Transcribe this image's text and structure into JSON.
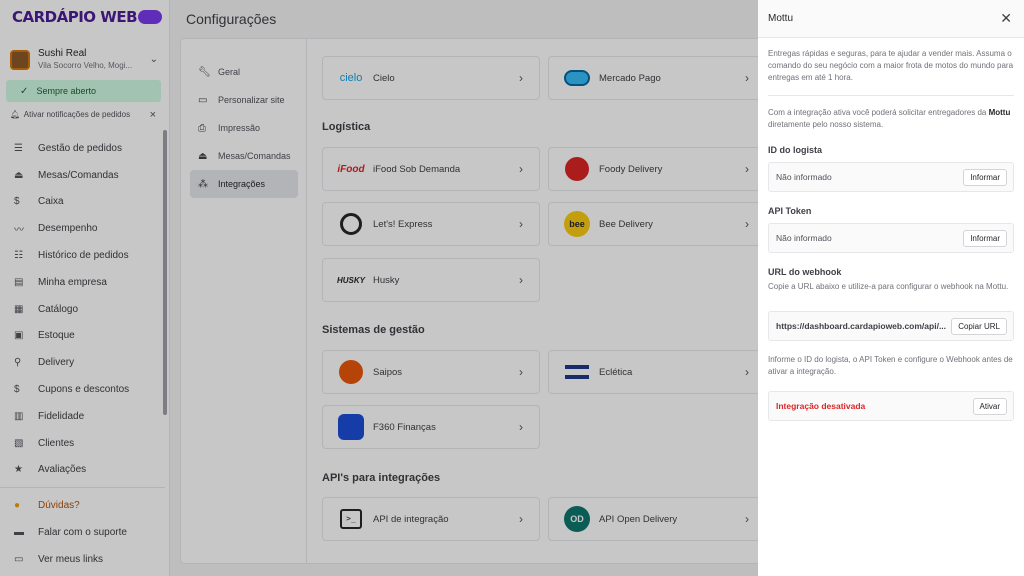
{
  "app": {
    "logo_text": "CARDÁPIO WEB"
  },
  "store": {
    "name": "Sushi Real",
    "address": "Vila Socorro Velho, Mogi..."
  },
  "status_badge": "Sempre aberto",
  "notifications_prompt": "Ativar notificações de pedidos",
  "menu": [
    {
      "label": "Gestão de pedidos",
      "icon": "orders-icon"
    },
    {
      "label": "Mesas/Comandas",
      "icon": "tables-icon"
    },
    {
      "label": "Caixa",
      "icon": "cash-icon"
    },
    {
      "label": "Desempenho",
      "icon": "chart-icon"
    },
    {
      "label": "Histórico de pedidos",
      "icon": "history-icon"
    },
    {
      "label": "Minha empresa",
      "icon": "store-icon"
    },
    {
      "label": "Catálogo",
      "icon": "catalog-icon"
    },
    {
      "label": "Estoque",
      "icon": "stock-icon"
    },
    {
      "label": "Delivery",
      "icon": "bike-icon"
    },
    {
      "label": "Cupons e descontos",
      "icon": "dollar-icon"
    },
    {
      "label": "Fidelidade",
      "icon": "gift-icon"
    },
    {
      "label": "Clientes",
      "icon": "contacts-icon"
    },
    {
      "label": "Avaliações",
      "icon": "star-icon"
    }
  ],
  "menu_bottom": [
    {
      "label": "Dúvidas?",
      "icon": "help-icon"
    },
    {
      "label": "Falar com o suporte",
      "icon": "chat-icon"
    },
    {
      "label": "Ver meus links",
      "icon": "links-icon"
    }
  ],
  "page_title": "Configurações",
  "settings_nav": [
    {
      "label": "Geral",
      "icon": "wrench-icon"
    },
    {
      "label": "Personalizar site",
      "icon": "browser-icon"
    },
    {
      "label": "Impressão",
      "icon": "printer-icon"
    },
    {
      "label": "Mesas/Comandas",
      "icon": "tables-icon"
    },
    {
      "label": "Integrações",
      "icon": "integrations-icon"
    }
  ],
  "payments": [
    {
      "name": "Cielo",
      "logo": "cielo"
    },
    {
      "name": "Mercado Pago",
      "logo": ""
    }
  ],
  "sections": {
    "logistics": "Logística",
    "management": "Sistemas de gestão",
    "apis": "API's para integrações"
  },
  "logistics": [
    {
      "name": "iFood Sob Demanda",
      "logo": "iFood"
    },
    {
      "name": "Foody Delivery",
      "logo": ""
    },
    {
      "name": "Let's! Express",
      "logo": ""
    },
    {
      "name": "Bee Delivery",
      "logo": "bee"
    },
    {
      "name": "Husky",
      "logo": "HUSKY"
    }
  ],
  "management": [
    {
      "name": "Saipos",
      "logo": ""
    },
    {
      "name": "Eclética",
      "logo": ""
    },
    {
      "name": "F360 Finanças",
      "logo": ""
    }
  ],
  "apis": [
    {
      "name": "API de integração",
      "logo": ">_"
    },
    {
      "name": "API Open Delivery",
      "logo": "OD"
    }
  ],
  "drawer": {
    "title": "Mottu",
    "intro": "Entregas rápidas e seguras, para te ajudar a vender mais. Assuma o comando do seu negócio com a maior frota de motos do mundo para entregas em até 1 hora.",
    "info_prefix": "Com a integração ativa você poderá solicitar entregadores da",
    "info_brand": "Mottu",
    "info_suffix": "diretamente pelo nosso sistema.",
    "store_id_label": "ID do logista",
    "store_id_value": "Não informado",
    "store_id_button": "Informar",
    "token_label": "API Token",
    "token_value": "Não informado",
    "token_button": "Informar",
    "webhook_label": "URL do webhook",
    "webhook_help": "Copie a URL abaixo e utilize-a para configurar o webhook na Mottu.",
    "webhook_url": "https://dashboard.cardapioweb.com/api/...",
    "webhook_button": "Copiar URL",
    "activation_help": "Informe o ID do logista, o API Token e configure o Webhook antes de ativar a integração.",
    "status_text": "Integração desativada",
    "activate_button": "Ativar"
  },
  "colors": {
    "accent": "#4c1d95",
    "status_open_bg": "#d1fae5",
    "status_off": "#dc2626"
  }
}
